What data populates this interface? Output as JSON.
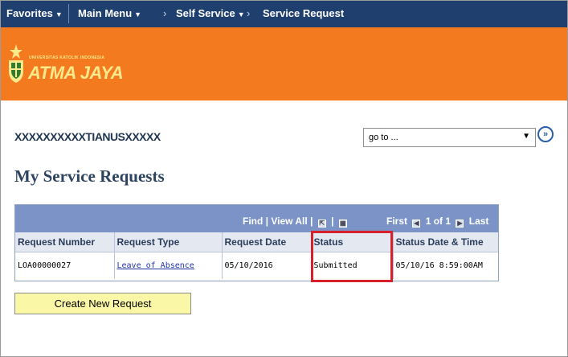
{
  "nav": {
    "favorites": "Favorites",
    "main_menu": "Main Menu",
    "chevron": "›",
    "self_service": "Self Service",
    "service_request": "Service Request",
    "caret": "▼"
  },
  "banner": {
    "university_small": "UNIVERSITAS KATOLIK INDONESIA",
    "university_name": "ATMA JAYA",
    "color": "#f47a20"
  },
  "user": {
    "name": "XXXXXXXXXXTIANUSXXXXX"
  },
  "goto": {
    "value": "go to ...",
    "arrow": "▼",
    "button": "»"
  },
  "page": {
    "title": "My Service Requests"
  },
  "grid": {
    "find": "Find",
    "divider": "|",
    "view_all": "View All",
    "first": "First",
    "page_info": "1 of 1",
    "last": "Last",
    "columns": [
      "Request Number",
      "Request Type",
      "Request Date",
      "Status",
      "Status Date & Time"
    ],
    "rows": [
      {
        "request_number": "LOA00000027",
        "request_type": "Leave of Absence",
        "request_date": "05/10/2016",
        "status": "Submitted",
        "status_datetime": "05/10/16  8:59:00AM"
      }
    ]
  },
  "actions": {
    "create_new_request": "Create New Request"
  },
  "colors": {
    "nav": "#1f3f6e",
    "grid_header": "#7c93c7",
    "highlight": "#d8202a",
    "button": "#faf7a6"
  }
}
